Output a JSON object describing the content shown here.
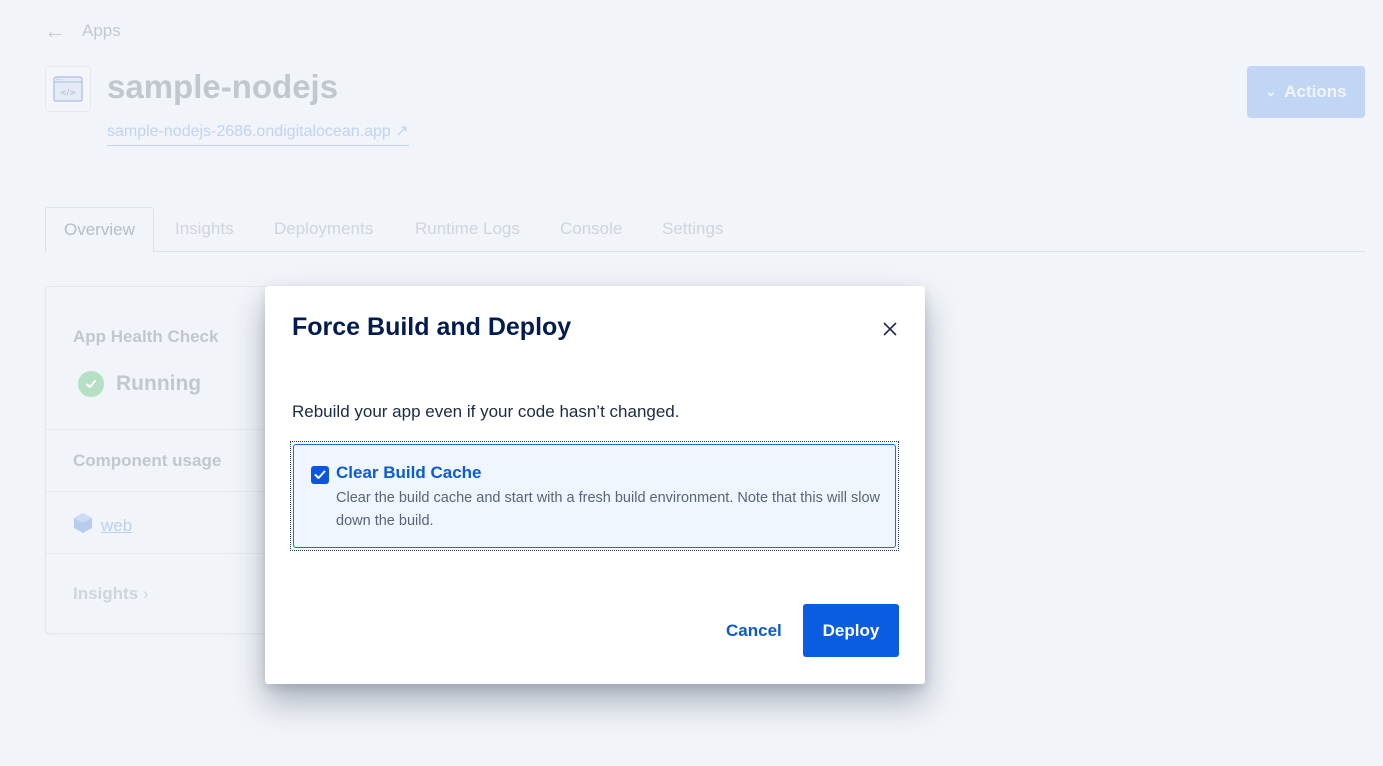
{
  "breadcrumb": {
    "back_label": "Apps",
    "back_icon": "arrow-left-icon"
  },
  "app": {
    "title": "sample-nodejs",
    "url": "sample-nodejs-2686.ondigitalocean.app",
    "url_icon": "external-link-icon",
    "icon": "code-window-icon"
  },
  "header": {
    "actions_label": "Actions",
    "actions_icon": "chevron-down-icon"
  },
  "tabs": [
    {
      "label": "Overview",
      "active": true
    },
    {
      "label": "Insights",
      "active": false
    },
    {
      "label": "Deployments",
      "active": false
    },
    {
      "label": "Runtime Logs",
      "active": false
    },
    {
      "label": "Console",
      "active": false
    },
    {
      "label": "Settings",
      "active": false
    }
  ],
  "overview": {
    "health_label": "App Health Check",
    "health_status": "Running",
    "component_usage_label": "Component usage",
    "component_name": "web",
    "insights_link": "Insights",
    "insights_chevron": "›"
  },
  "modal": {
    "title": "Force Build and Deploy",
    "description": "Rebuild your app even if your code hasn’t changed.",
    "option": {
      "title": "Clear Build Cache",
      "description": "Clear the build cache and start with a fresh build environment. Note that this will slow down the build.",
      "checked": true
    },
    "cancel_label": "Cancel",
    "deploy_label": "Deploy"
  },
  "colors": {
    "primary": "#0a5ce0",
    "title": "#031b4e",
    "background": "#f1f4f8"
  }
}
